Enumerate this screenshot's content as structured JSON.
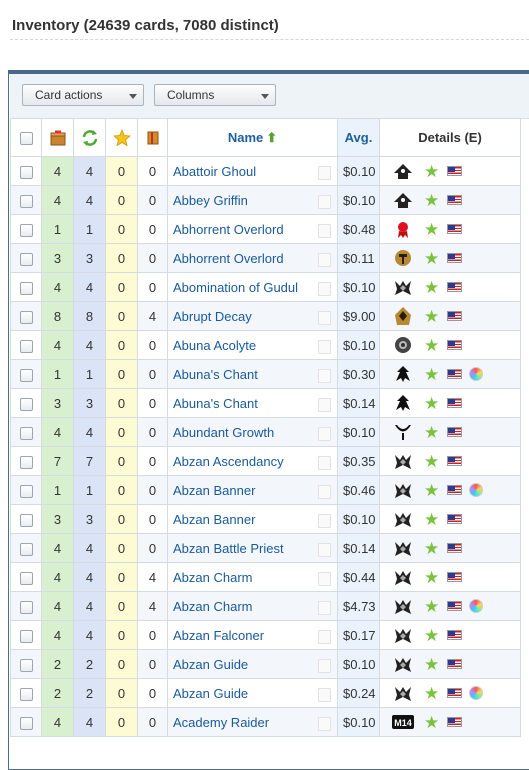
{
  "page": {
    "title": "Inventory (24639 cards, 7080 distinct)"
  },
  "toolbar": {
    "card_actions": "Card actions",
    "columns": "Columns"
  },
  "table": {
    "headers": {
      "name": "Name",
      "avg": "Avg.",
      "details": "Details (E)"
    },
    "rows": [
      {
        "q": "4",
        "t": "4",
        "w": "0",
        "n": "0",
        "name": "Abattoir Ghoul",
        "price": "$0.10",
        "set": "innistrad-icon",
        "foil": false
      },
      {
        "q": "4",
        "t": "4",
        "w": "0",
        "n": "0",
        "name": "Abbey Griffin",
        "price": "$0.10",
        "set": "innistrad-icon",
        "foil": false
      },
      {
        "q": "1",
        "t": "1",
        "w": "0",
        "n": "0",
        "name": "Abhorrent Overlord",
        "price": "$0.48",
        "set": "promo-icon",
        "foil": false
      },
      {
        "q": "3",
        "t": "3",
        "w": "0",
        "n": "0",
        "name": "Abhorrent Overlord",
        "price": "$0.11",
        "set": "theros-icon",
        "foil": false
      },
      {
        "q": "4",
        "t": "4",
        "w": "0",
        "n": "0",
        "name": "Abomination of Gudul",
        "price": "$0.10",
        "set": "ktk-icon",
        "foil": false
      },
      {
        "q": "8",
        "t": "8",
        "w": "0",
        "n": "4",
        "name": "Abrupt Decay",
        "price": "$9.00",
        "set": "rtr-icon",
        "foil": false
      },
      {
        "q": "4",
        "t": "4",
        "w": "0",
        "n": "0",
        "name": "Abuna Acolyte",
        "price": "$0.10",
        "set": "som-icon",
        "foil": false
      },
      {
        "q": "1",
        "t": "1",
        "w": "0",
        "n": "0",
        "name": "Abuna's Chant",
        "price": "$0.30",
        "set": "fifth-dawn-icon",
        "foil": true
      },
      {
        "q": "3",
        "t": "3",
        "w": "0",
        "n": "0",
        "name": "Abuna's Chant",
        "price": "$0.14",
        "set": "fifth-dawn-icon",
        "foil": false
      },
      {
        "q": "4",
        "t": "4",
        "w": "0",
        "n": "0",
        "name": "Abundant Growth",
        "price": "$0.10",
        "set": "avr-icon",
        "foil": false
      },
      {
        "q": "7",
        "t": "7",
        "w": "0",
        "n": "0",
        "name": "Abzan Ascendancy",
        "price": "$0.35",
        "set": "ktk-icon",
        "foil": false
      },
      {
        "q": "1",
        "t": "1",
        "w": "0",
        "n": "0",
        "name": "Abzan Banner",
        "price": "$0.46",
        "set": "ktk-icon",
        "foil": true
      },
      {
        "q": "3",
        "t": "3",
        "w": "0",
        "n": "0",
        "name": "Abzan Banner",
        "price": "$0.10",
        "set": "ktk-icon",
        "foil": false
      },
      {
        "q": "4",
        "t": "4",
        "w": "0",
        "n": "0",
        "name": "Abzan Battle Priest",
        "price": "$0.14",
        "set": "ktk-icon",
        "foil": false
      },
      {
        "q": "4",
        "t": "4",
        "w": "0",
        "n": "4",
        "name": "Abzan Charm",
        "price": "$0.44",
        "set": "ktk-icon",
        "foil": false
      },
      {
        "q": "4",
        "t": "4",
        "w": "0",
        "n": "4",
        "name": "Abzan Charm",
        "price": "$4.73",
        "set": "ktk-icon",
        "foil": true
      },
      {
        "q": "4",
        "t": "4",
        "w": "0",
        "n": "0",
        "name": "Abzan Falconer",
        "price": "$0.17",
        "set": "ktk-icon",
        "foil": false
      },
      {
        "q": "2",
        "t": "2",
        "w": "0",
        "n": "0",
        "name": "Abzan Guide",
        "price": "$0.10",
        "set": "ktk-icon",
        "foil": false
      },
      {
        "q": "2",
        "t": "2",
        "w": "0",
        "n": "0",
        "name": "Abzan Guide",
        "price": "$0.24",
        "set": "ktk-icon",
        "foil": true
      },
      {
        "q": "4",
        "t": "4",
        "w": "0",
        "n": "0",
        "name": "Academy Raider",
        "price": "$0.10",
        "set": "m14-icon",
        "foil": false
      }
    ]
  },
  "colors": {
    "qty": "#d8f0cf",
    "trade": "#dbe4f7",
    "wish": "#fdfbd3",
    "link": "#1a5a99",
    "accent": "#44698b"
  }
}
